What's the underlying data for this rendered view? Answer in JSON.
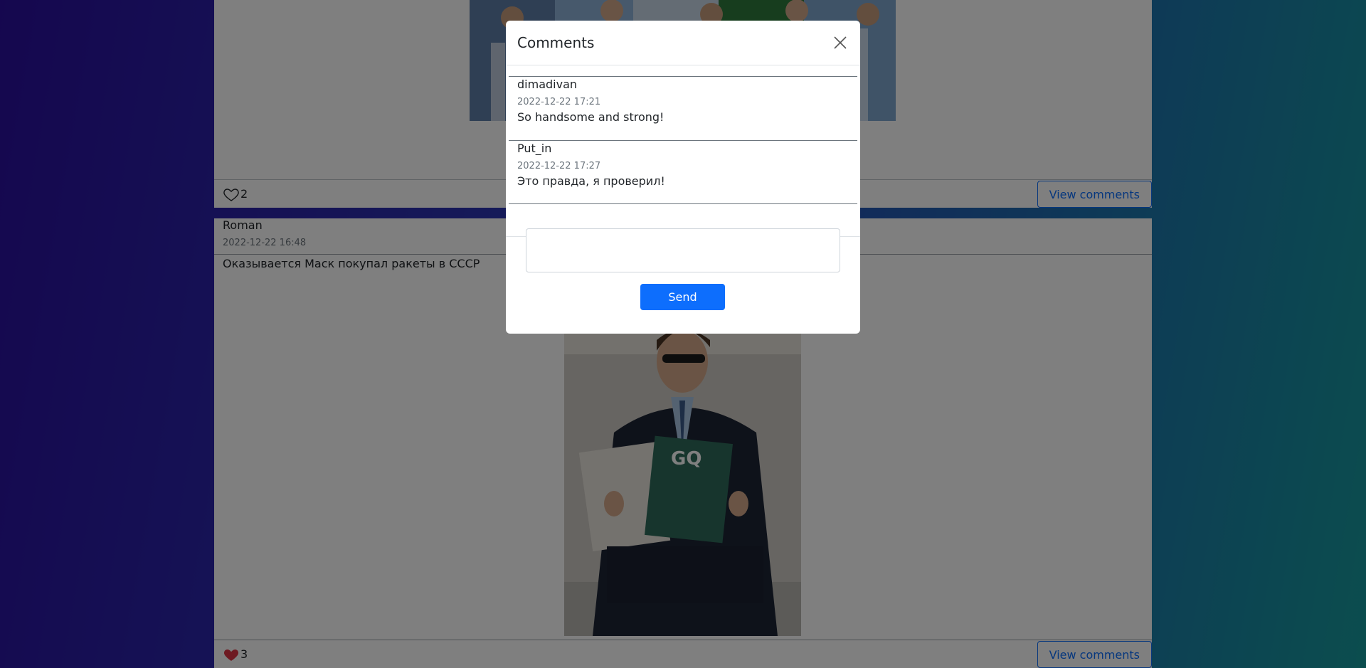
{
  "posts": [
    {
      "likes": "2",
      "liked": false,
      "view_comments_label": "View comments"
    },
    {
      "author": "Roman",
      "date": "2022-12-22 16:48",
      "text": "Оказывается Маск покупал ракеты в СССР",
      "likes": "3",
      "liked": true,
      "view_comments_label": "View comments"
    }
  ],
  "modal": {
    "title": "Comments",
    "comments": [
      {
        "author": "dimadivan",
        "date": "2022-12-22 17:21",
        "text": "So handsome and strong!"
      },
      {
        "author": "Put_in",
        "date": "2022-12-22 17:27",
        "text": "Это правда, я проверил!"
      }
    ],
    "input_value": "",
    "send_label": "Send"
  },
  "colors": {
    "primary": "#0d6efd",
    "like_active": "#dc3545"
  },
  "icons": {
    "close": "close-icon",
    "heart_outline": "heart-outline-icon",
    "heart_filled": "heart-filled-icon"
  }
}
